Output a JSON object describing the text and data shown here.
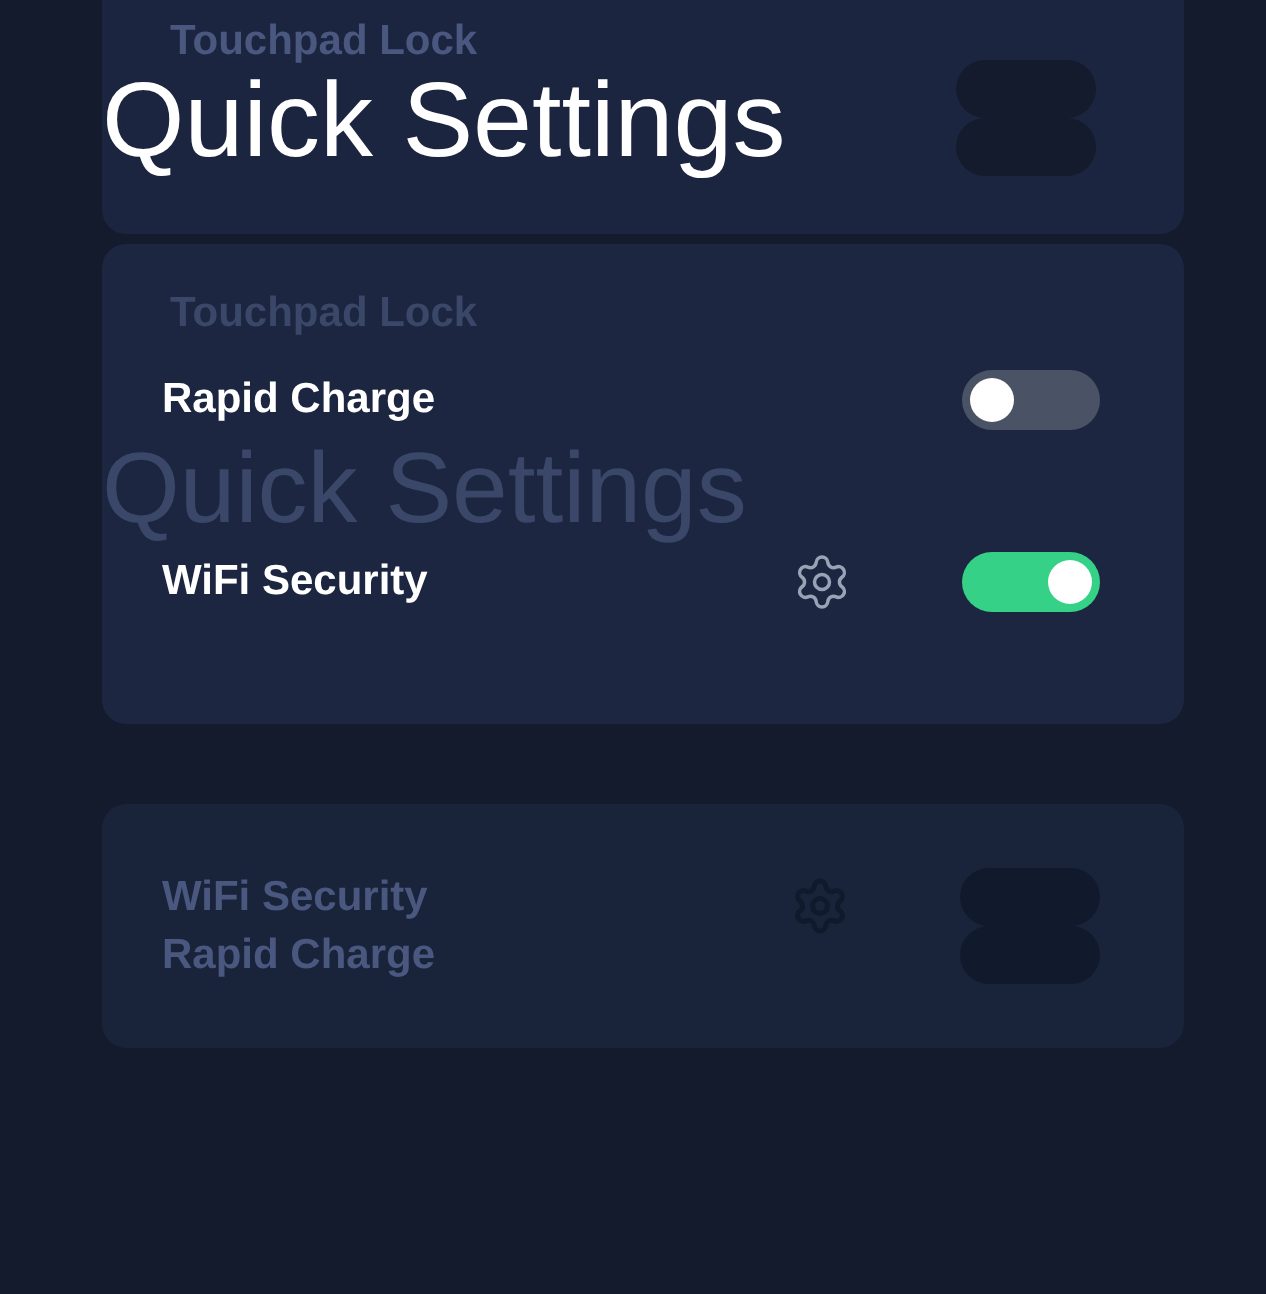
{
  "title": "Quick Settings",
  "top_card": {
    "ghost_label": "Touchpad Lock"
  },
  "main_card": {
    "ghost_label": "Touchpad Lock",
    "ghost_title": "Quick Settings",
    "rows": [
      {
        "label": "Rapid Charge",
        "kind": "toggle",
        "on": false
      },
      {
        "label": "WiFi Security",
        "kind": "toggle_gear",
        "on": true
      }
    ]
  },
  "bottom_card": {
    "labels": [
      "WiFi Security",
      "Rapid Charge"
    ]
  }
}
